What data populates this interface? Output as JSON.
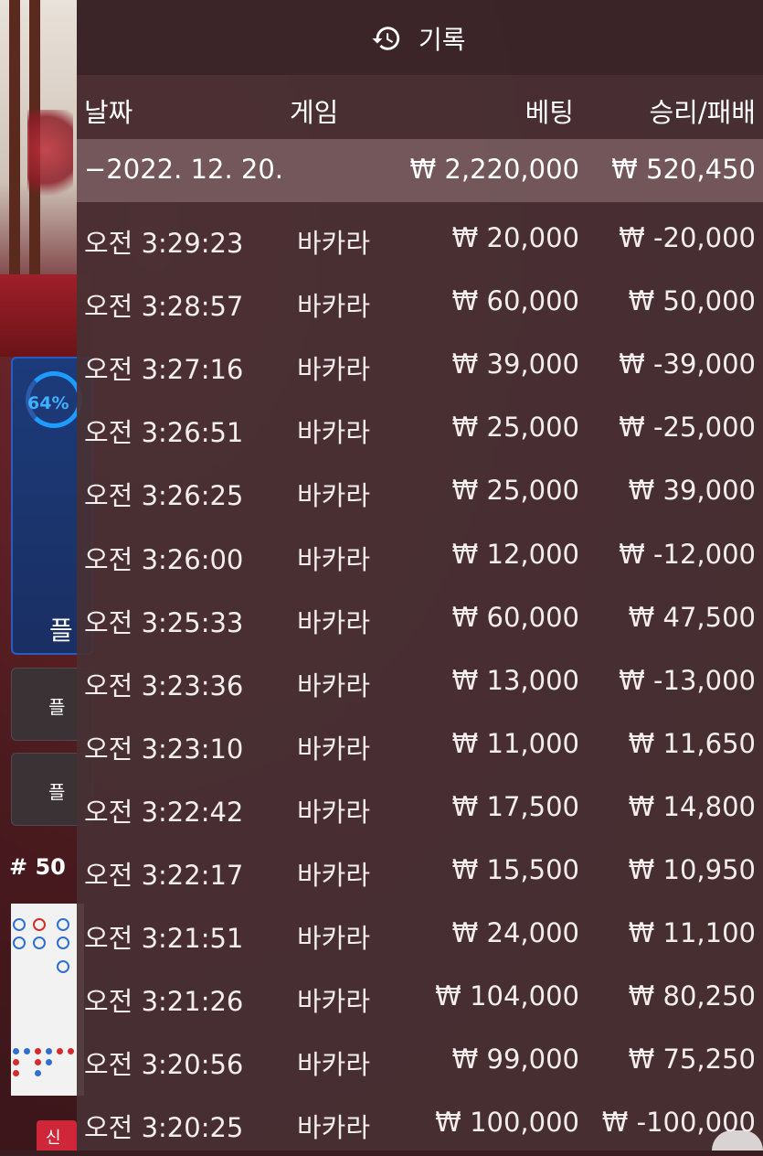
{
  "background": {
    "progress_percent_label": "64%",
    "panel_label": "플",
    "side_button_1": "플",
    "side_button_2": "플",
    "round_number": "# 50",
    "new_tag": "신"
  },
  "history": {
    "title": "기록",
    "columns": {
      "date": "날짜",
      "game": "게임",
      "bet": "베팅",
      "result": "승리/패배"
    },
    "summary": {
      "date": "−2022. 12. 20.",
      "bet": "₩ 2,220,000",
      "result": "₩ 520,450"
    },
    "rows": [
      {
        "time": "오전 3:29:23",
        "game": "바카라",
        "bet": "₩ 20,000",
        "result": "₩ -20,000"
      },
      {
        "time": "오전 3:28:57",
        "game": "바카라",
        "bet": "₩ 60,000",
        "result": "₩ 50,000"
      },
      {
        "time": "오전 3:27:16",
        "game": "바카라",
        "bet": "₩ 39,000",
        "result": "₩ -39,000"
      },
      {
        "time": "오전 3:26:51",
        "game": "바카라",
        "bet": "₩ 25,000",
        "result": "₩ -25,000"
      },
      {
        "time": "오전 3:26:25",
        "game": "바카라",
        "bet": "₩ 25,000",
        "result": "₩ 39,000"
      },
      {
        "time": "오전 3:26:00",
        "game": "바카라",
        "bet": "₩ 12,000",
        "result": "₩ -12,000"
      },
      {
        "time": "오전 3:25:33",
        "game": "바카라",
        "bet": "₩ 60,000",
        "result": "₩ 47,500"
      },
      {
        "time": "오전 3:23:36",
        "game": "바카라",
        "bet": "₩ 13,000",
        "result": "₩ -13,000"
      },
      {
        "time": "오전 3:23:10",
        "game": "바카라",
        "bet": "₩ 11,000",
        "result": "₩ 11,650"
      },
      {
        "time": "오전 3:22:42",
        "game": "바카라",
        "bet": "₩ 17,500",
        "result": "₩ 14,800"
      },
      {
        "time": "오전 3:22:17",
        "game": "바카라",
        "bet": "₩ 15,500",
        "result": "₩ 10,950"
      },
      {
        "time": "오전 3:21:51",
        "game": "바카라",
        "bet": "₩ 24,000",
        "result": "₩ 11,100"
      },
      {
        "time": "오전 3:21:26",
        "game": "바카라",
        "bet": "₩ 104,000",
        "result": "₩ 80,250"
      },
      {
        "time": "오전 3:20:56",
        "game": "바카라",
        "bet": "₩ 99,000",
        "result": "₩ 75,250"
      },
      {
        "time": "오전 3:20:25",
        "game": "바카라",
        "bet": "₩ 100,000",
        "result": "₩ -100,000"
      }
    ]
  }
}
